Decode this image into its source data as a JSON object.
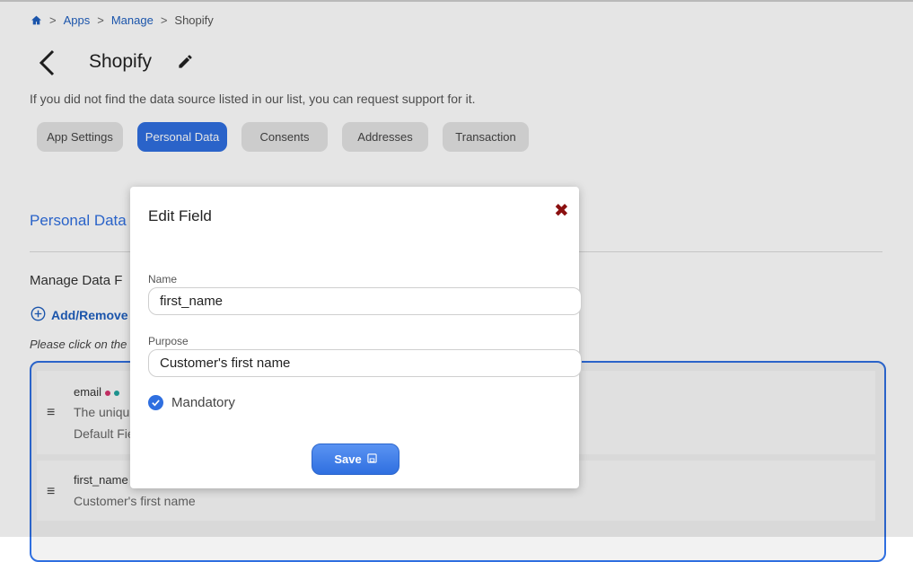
{
  "breadcrumb": {
    "items": [
      "Apps",
      "Manage"
    ],
    "current": "Shopify",
    "separator": ">"
  },
  "header": {
    "title": "Shopify"
  },
  "info_text": "If you did not find the data source listed in our list, you can request support for it.",
  "tabs": [
    {
      "label": "App Settings",
      "active": false
    },
    {
      "label": "Personal Data",
      "active": true
    },
    {
      "label": "Consents",
      "active": false
    },
    {
      "label": "Addresses",
      "active": false
    },
    {
      "label": "Transaction",
      "active": false
    }
  ],
  "section": {
    "title": "Personal Data",
    "manage_label": "Manage Data F",
    "add_remove_label": "Add/Remove",
    "hint": "Please click on the"
  },
  "fields": [
    {
      "name": "email",
      "desc": "The uniqu",
      "extra": "Default Fie"
    },
    {
      "name": "first_name",
      "desc": "Customer's first name"
    }
  ],
  "modal": {
    "title": "Edit Field",
    "name_label": "Name",
    "name_value": "first_name",
    "purpose_label": "Purpose",
    "purpose_value": "Customer's first name",
    "mandatory_label": "Mandatory",
    "mandatory_checked": true,
    "save_label": "Save"
  },
  "colors": {
    "accent": "#2f6fe0",
    "link": "#1f5fbf",
    "close": "#8b1010",
    "dot_pink": "#d6336c",
    "dot_teal": "#20a39e"
  },
  "icons": {
    "home": "home-icon",
    "back": "chevron-left-icon",
    "edit": "pencil-icon",
    "add": "plus-circle-icon",
    "drag": "drag-handle-icon",
    "close": "close-icon",
    "check": "check-icon",
    "save": "floppy-disk-icon"
  }
}
